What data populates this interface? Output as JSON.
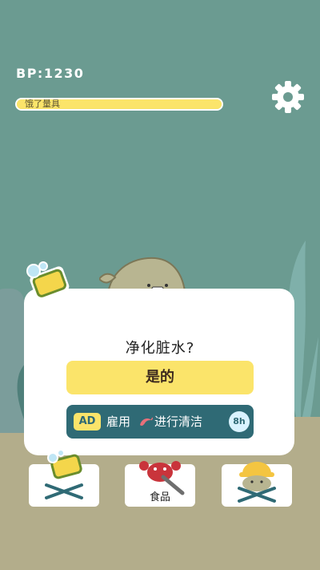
{
  "hud": {
    "bp_label": "BP:1230",
    "hunger_label": "饿了量具",
    "hunger_fraction": 1.0,
    "settings_icon": "gear-icon"
  },
  "dialog": {
    "question": "净化脏水?",
    "confirm_label": "是的",
    "ad": {
      "tag": "AD",
      "label_pre": "雇用",
      "label_post": "进行清洁",
      "timer": "8h"
    }
  },
  "slots": [
    {
      "name": "cleaning",
      "icon": "sponge-icon",
      "label": ""
    },
    {
      "name": "food",
      "icon": "crab-icon",
      "label": "食品"
    },
    {
      "name": "helper",
      "icon": "fish-hardhat-icon",
      "label": ""
    }
  ],
  "colors": {
    "background": "#6b9b91",
    "accent_yellow": "#fbe46a",
    "ad_button": "#2f6a75",
    "card": "#ffffff"
  }
}
